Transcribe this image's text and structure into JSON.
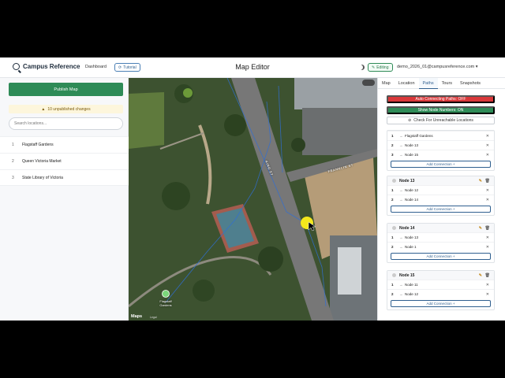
{
  "header": {
    "brand_name": "Campus Reference",
    "nav_dashboard": "Dashboard",
    "nav_tutorial": "Tutorial",
    "page_title": "Map Editor",
    "status_badge": "Editing",
    "user_email": "demo_2026_01@campusreference.com"
  },
  "sidebar": {
    "publish_label": "Publish Map",
    "warning_text": "10 unpublished changes",
    "search_placeholder": "Search locations...",
    "locations": [
      {
        "num": "1",
        "name": "Flagstaff Gardens"
      },
      {
        "num": "2",
        "name": "Queen Victoria Market"
      },
      {
        "num": "3",
        "name": "State Library of Victoria"
      }
    ]
  },
  "map": {
    "pin_label_line1": "Flagstaff",
    "pin_label_line2": "Gardens",
    "street_1": "KING ST",
    "street_2": "FRANKLIN ST",
    "attribution": "Maps",
    "legal": "Legal"
  },
  "panel": {
    "tabs": [
      "Map",
      "Location",
      "Paths",
      "Tours",
      "Snapshots"
    ],
    "active_tab": "Paths",
    "btn_auto": "Auto Connecting Paths: OFF",
    "btn_shownum": "Show Node Numbers: ON",
    "btn_check": "Check For Unreachable Locations",
    "add_connection_label": "Add Connection +",
    "nodes": [
      {
        "title": "",
        "connections": [
          {
            "num": "1",
            "target": "Flagstaff Gardens"
          },
          {
            "num": "2",
            "target": "Node 13"
          },
          {
            "num": "3",
            "target": "Node 15"
          }
        ]
      },
      {
        "title": "Node 13",
        "connections": [
          {
            "num": "1",
            "target": "Node 12"
          },
          {
            "num": "2",
            "target": "Node 14"
          }
        ]
      },
      {
        "title": "Node 14",
        "connections": [
          {
            "num": "1",
            "target": "Node 13"
          },
          {
            "num": "2",
            "target": "Node 1"
          }
        ]
      },
      {
        "title": "Node 15",
        "connections": [
          {
            "num": "1",
            "target": "Node 11"
          },
          {
            "num": "2",
            "target": "Node 12"
          }
        ]
      }
    ]
  },
  "colors": {
    "primary_green": "#2e8b57",
    "danger_red": "#d9383a",
    "accent_blue": "#2f5f8f",
    "node_marker_yellow": "#f4e71c",
    "pin_green": "#7bd67b",
    "path_blue": "#2f6fd6"
  }
}
